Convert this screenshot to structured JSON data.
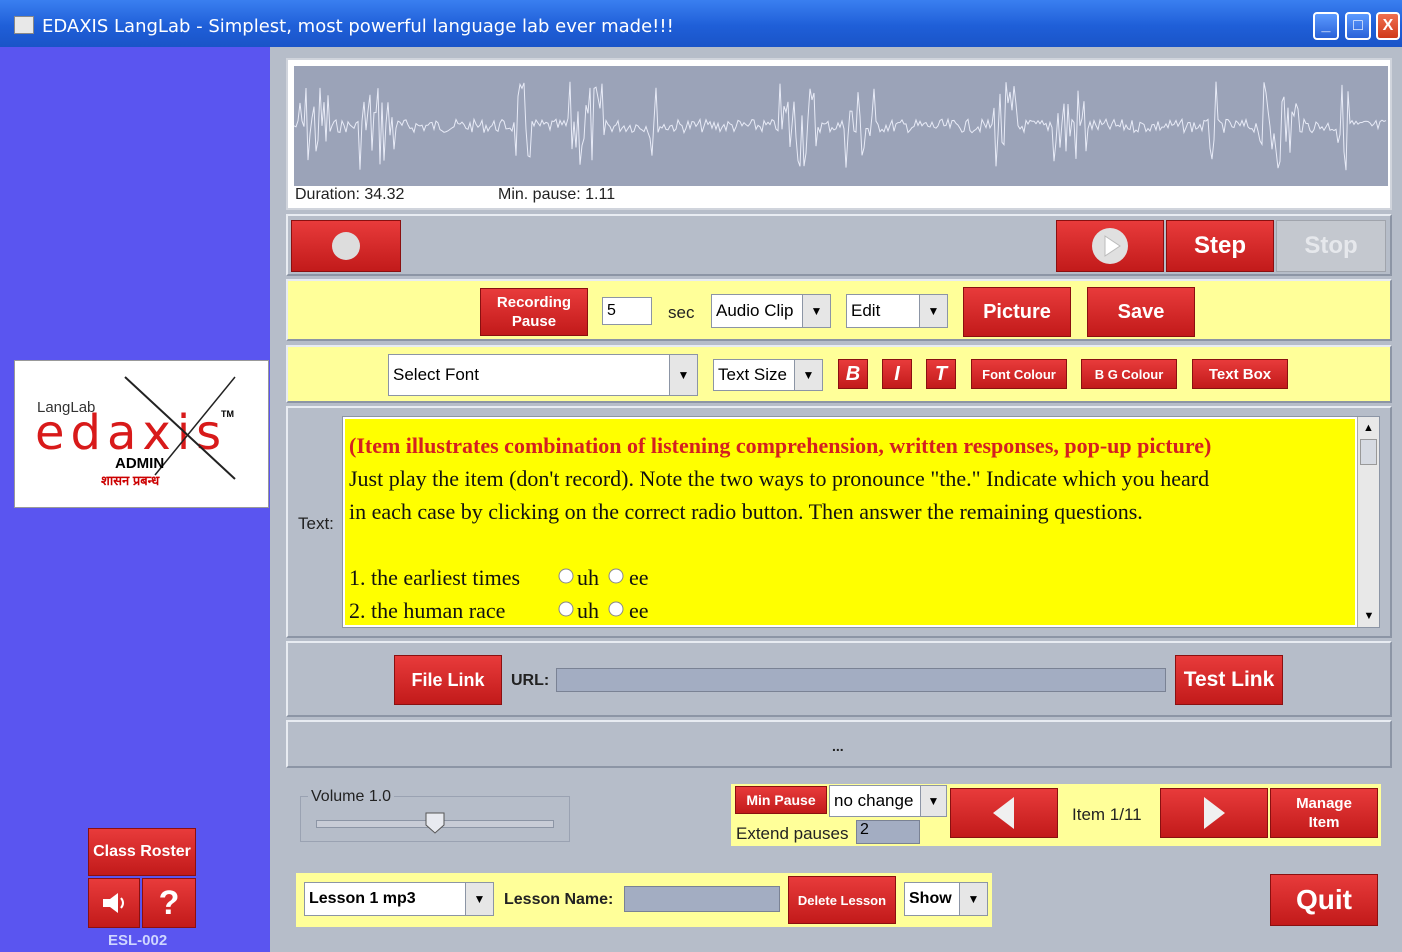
{
  "window": {
    "title": "EDAXIS LangLab - Simplest, most powerful language lab ever made!!!",
    "min": "_",
    "max": "□",
    "close": "X"
  },
  "logo": {
    "langlab": "LangLab",
    "edaxis": "edaxis",
    "tm": "TM",
    "admin": "ADMIN",
    "hindi": "शासन प्रबन्ध"
  },
  "waveform": {
    "duration": "Duration: 34.32",
    "min_pause": "Min. pause: 1.11"
  },
  "transport": {
    "step": "Step",
    "stop": "Stop"
  },
  "recording": {
    "pause_btn": "Recording Pause",
    "seconds": "5",
    "sec_label": "sec",
    "clip_type": "Audio Clip",
    "mode": "Edit",
    "picture": "Picture",
    "save": "Save"
  },
  "format": {
    "font": "Select Font",
    "size": "Text Size",
    "bold": "B",
    "italic": "I",
    "t": "T",
    "font_colour": "Font Colour",
    "bg_colour": "B G Colour",
    "text_box": "Text Box"
  },
  "text": {
    "label": "Text:",
    "heading": "(Item illustrates combination of listening comprehension, written responses, pop-up picture)",
    "line1": "Just play the item (don't record). Note the two ways to pronounce \"the.\" Indicate which you heard",
    "line2": "in each case by clicking on the correct radio button. Then answer the remaining questions.",
    "q1": "1. the earliest times",
    "q2": "2. the human race",
    "opt_uh": "uh",
    "opt_ee": "ee"
  },
  "link": {
    "file_link": "File Link",
    "url_label": "URL:",
    "url_value": "",
    "test_link": "Test Link"
  },
  "ellipsis": "...",
  "volume": {
    "label": "Volume 1.0",
    "level": 0.5
  },
  "pause": {
    "min_pause": "Min Pause",
    "mode": "no change",
    "extend_label": "Extend pauses",
    "extend_value": "2"
  },
  "nav": {
    "item": "Item 1/11",
    "manage": "Manage Item"
  },
  "lesson": {
    "selected": "Lesson 1 mp3",
    "name_label": "Lesson Name:",
    "name_value": "",
    "delete": "Delete Lesson",
    "show": "Show"
  },
  "quit": "Quit",
  "sidebar": {
    "class_roster": "Class Roster",
    "help": "?",
    "station": "ESL-002"
  }
}
